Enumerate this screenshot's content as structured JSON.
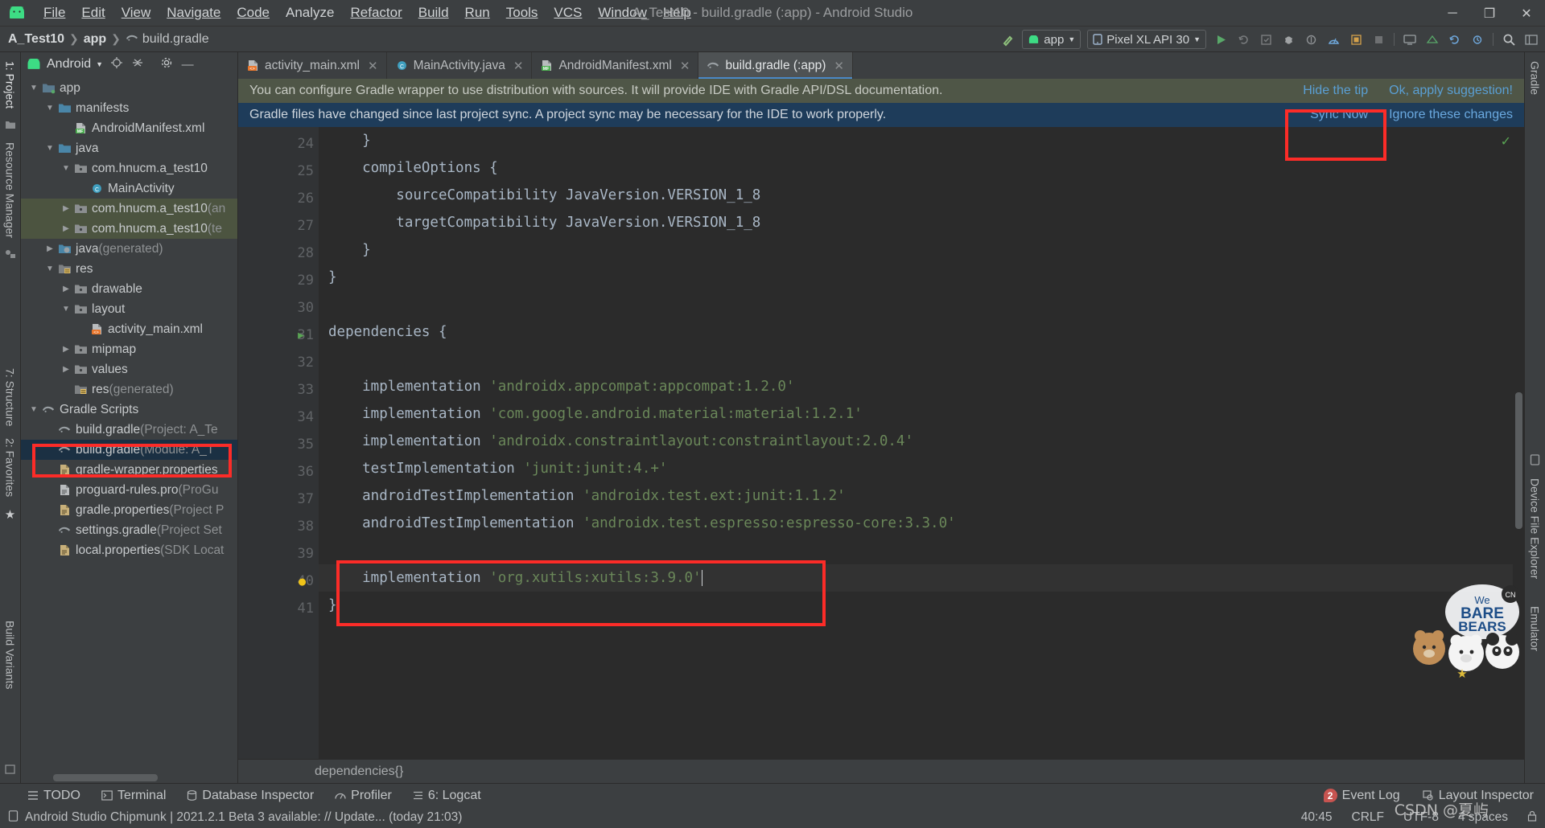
{
  "window": {
    "title": "A_Test10 - build.gradle (:app) - Android Studio",
    "minimize": "─",
    "maximize": "❐",
    "close": "✕"
  },
  "menu": {
    "items": [
      {
        "label": "File"
      },
      {
        "label": "Edit"
      },
      {
        "label": "View"
      },
      {
        "label": "Navigate"
      },
      {
        "label": "Code"
      },
      {
        "label": "Analyze"
      },
      {
        "label": "Refactor"
      },
      {
        "label": "Build"
      },
      {
        "label": "Run"
      },
      {
        "label": "Tools"
      },
      {
        "label": "VCS"
      },
      {
        "label": "Window"
      },
      {
        "label": "Help"
      }
    ]
  },
  "navbar": {
    "breadcrumbs": [
      "A_Test10",
      "app",
      "build.gradle"
    ],
    "module_combo": "app",
    "device_combo": "Pixel XL API 30",
    "icons": [
      "hammer-icon",
      "run-icon",
      "rerun-icon",
      "apply-changes-icon",
      "debug-icon",
      "attach-debugger-icon",
      "profile-icon",
      "layout-inspector-icon",
      "stop-icon",
      "avd-manager-icon",
      "sdk-manager-icon",
      "sync-gradle-icon",
      "search-everywhere-icon",
      "project-structure-icon"
    ]
  },
  "leftstrip": {
    "project_tab": "1: Project",
    "resource_tab": "Resource Manager",
    "structure_tab": "7: Structure",
    "favorites_tab": "2: Favorites",
    "buildvariants_tab": "Build Variants"
  },
  "rightstrip": {
    "gradle_tab": "Gradle",
    "device_tab": "Device File Explorer",
    "emulator_tab": "Emulator"
  },
  "project_panel": {
    "title": "Android",
    "icons": [
      "android-icon",
      "chevron-down-icon",
      "locate-icon",
      "collapse-all-icon",
      "settings-gear-icon",
      "hide-icon"
    ],
    "tree": [
      {
        "label": "app",
        "depth": 0,
        "arrow": "▼",
        "icon": "module-icon",
        "suffix": ""
      },
      {
        "label": "manifests",
        "depth": 1,
        "arrow": "▼",
        "icon": "folder-icon",
        "suffix": ""
      },
      {
        "label": "AndroidManifest.xml",
        "depth": 2,
        "arrow": "",
        "icon": "manifest-file-icon",
        "suffix": ""
      },
      {
        "label": "java",
        "depth": 1,
        "arrow": "▼",
        "icon": "folder-icon",
        "suffix": ""
      },
      {
        "label": "com.hnucm.a_test10",
        "depth": 2,
        "arrow": "▼",
        "icon": "package-icon",
        "suffix": ""
      },
      {
        "label": "MainActivity",
        "depth": 3,
        "arrow": "",
        "icon": "class-icon",
        "suffix": ""
      },
      {
        "label": "com.hnucm.a_test10",
        "depth": 2,
        "arrow": "▶",
        "icon": "package-icon",
        "suffix": " (an"
      },
      {
        "label": "com.hnucm.a_test10",
        "depth": 2,
        "arrow": "▶",
        "icon": "package-icon",
        "suffix": " (te"
      },
      {
        "label": "java",
        "depth": 1,
        "arrow": "▶",
        "icon": "generated-folder-icon",
        "suffix": " (generated)"
      },
      {
        "label": "res",
        "depth": 1,
        "arrow": "▼",
        "icon": "res-folder-icon",
        "suffix": ""
      },
      {
        "label": "drawable",
        "depth": 2,
        "arrow": "▶",
        "icon": "package-icon",
        "suffix": ""
      },
      {
        "label": "layout",
        "depth": 2,
        "arrow": "▼",
        "icon": "package-icon",
        "suffix": ""
      },
      {
        "label": "activity_main.xml",
        "depth": 3,
        "arrow": "",
        "icon": "layout-file-icon",
        "suffix": ""
      },
      {
        "label": "mipmap",
        "depth": 2,
        "arrow": "▶",
        "icon": "package-icon",
        "suffix": ""
      },
      {
        "label": "values",
        "depth": 2,
        "arrow": "▶",
        "icon": "package-icon",
        "suffix": ""
      },
      {
        "label": "res",
        "depth": 2,
        "arrow": "",
        "icon": "res-folder-icon",
        "suffix": " (generated)"
      },
      {
        "label": "Gradle Scripts",
        "depth": 0,
        "arrow": "▼",
        "icon": "gradle-icon",
        "suffix": ""
      },
      {
        "label": "build.gradle",
        "depth": 1,
        "arrow": "",
        "icon": "gradle-icon",
        "suffix": " (Project: A_Te"
      },
      {
        "label": "build.gradle",
        "depth": 1,
        "arrow": "",
        "icon": "gradle-icon",
        "suffix": " (Module: A_T"
      },
      {
        "label": "gradle-wrapper.properties",
        "depth": 1,
        "arrow": "",
        "icon": "properties-icon",
        "suffix": ""
      },
      {
        "label": "proguard-rules.pro",
        "depth": 1,
        "arrow": "",
        "icon": "text-file-icon",
        "suffix": " (ProGu"
      },
      {
        "label": "gradle.properties",
        "depth": 1,
        "arrow": "",
        "icon": "properties-icon",
        "suffix": " (Project P"
      },
      {
        "label": "settings.gradle",
        "depth": 1,
        "arrow": "",
        "icon": "gradle-icon",
        "suffix": " (Project Set"
      },
      {
        "label": "local.properties",
        "depth": 1,
        "arrow": "",
        "icon": "properties-icon",
        "suffix": " (SDK Locat"
      }
    ],
    "selected_index": 18,
    "test_source_indices": [
      6,
      7
    ]
  },
  "editor": {
    "tabs": [
      {
        "label": "activity_main.xml",
        "icon": "layout-file-icon",
        "active": false,
        "close": "✕"
      },
      {
        "label": "MainActivity.java",
        "icon": "class-icon",
        "active": false,
        "close": "✕"
      },
      {
        "label": "AndroidManifest.xml",
        "icon": "manifest-file-icon",
        "active": false,
        "close": "✕"
      },
      {
        "label": "build.gradle (:app)",
        "icon": "gradle-icon",
        "active": true,
        "close": "✕"
      }
    ],
    "tip_banner": {
      "text": "You can configure Gradle wrapper to use distribution with sources. It will provide IDE with Gradle API/DSL documentation.",
      "link1": "Hide the tip",
      "link2": "Ok, apply suggestion!"
    },
    "sync_banner": {
      "text": "Gradle files have changed since last project sync. A project sync may be necessary for the IDE to work properly.",
      "link1": "Sync Now",
      "link2": "Ignore these changes"
    },
    "code_lines": [
      {
        "n": "24",
        "text": "    }",
        "fold": "⊖",
        "type": "plain"
      },
      {
        "n": "25",
        "text": "    compileOptions {",
        "fold": "⊖",
        "type": "plain"
      },
      {
        "n": "26",
        "text": "        sourceCompatibility JavaVersion.VERSION_1_8",
        "fold": "",
        "type": "plain"
      },
      {
        "n": "27",
        "text": "        targetCompatibility JavaVersion.VERSION_1_8",
        "fold": "",
        "type": "plain"
      },
      {
        "n": "28",
        "text": "    }",
        "fold": "⊖",
        "type": "plain"
      },
      {
        "n": "29",
        "text": "}",
        "fold": "⊖",
        "type": "plain"
      },
      {
        "n": "30",
        "text": "",
        "fold": "",
        "type": "plain"
      },
      {
        "n": "31",
        "text": "dependencies {",
        "fold": "⊖",
        "type": "run",
        "run": "▶"
      },
      {
        "n": "32",
        "text": "",
        "fold": "",
        "type": "plain"
      },
      {
        "n": "33",
        "code": "    implementation ",
        "string": "'androidx.appcompat:appcompat:1.2.0'",
        "type": "dep"
      },
      {
        "n": "34",
        "code": "    implementation ",
        "string": "'com.google.android.material:material:1.2.1'",
        "type": "dep"
      },
      {
        "n": "35",
        "code": "    implementation ",
        "string": "'androidx.constraintlayout:constraintlayout:2.0.4'",
        "type": "dep"
      },
      {
        "n": "36",
        "code": "    testImplementation ",
        "string": "'junit:junit:4.+'",
        "type": "dep"
      },
      {
        "n": "37",
        "code": "    androidTestImplementation ",
        "string": "'androidx.test.ext:junit:1.1.2'",
        "type": "dep"
      },
      {
        "n": "38",
        "code": "    androidTestImplementation ",
        "string": "'androidx.test.espresso:espresso-core:3.3.0'",
        "type": "dep"
      },
      {
        "n": "39",
        "text": "",
        "fold": "",
        "type": "plain"
      },
      {
        "n": "40",
        "code": "    implementation ",
        "string": "'org.xutils:xutils:3.9.0'",
        "type": "dep-current",
        "bulb": "💡"
      },
      {
        "n": "41",
        "text": "}",
        "fold": "⊖",
        "type": "plain"
      }
    ],
    "breadcrumb": "dependencies{}"
  },
  "toolwindows": {
    "left_items": [
      {
        "label": "TODO",
        "icon": "todo-icon"
      },
      {
        "label": "Terminal",
        "icon": "terminal-icon"
      },
      {
        "label": "Database Inspector",
        "icon": "database-icon"
      },
      {
        "label": "Profiler",
        "icon": "profiler-icon"
      },
      {
        "label": "6: Logcat",
        "icon": "logcat-icon"
      }
    ],
    "right_items": [
      {
        "label": "Event Log",
        "icon": "event-log-icon",
        "badge": "2"
      },
      {
        "label": "Layout Inspector",
        "icon": "layout-inspector-icon",
        "badge": ""
      }
    ]
  },
  "statusbar": {
    "message": "Android Studio Chipmunk | 2021.2.1 Beta 3 available: // Update... (today 21:03)",
    "caret": "40:45",
    "line_ending": "CRLF",
    "encoding": "UTF-8",
    "indent": "4 spaces",
    "lock_icon": "lock-icon"
  },
  "watermark": {
    "text": "CSDN @夏屿"
  },
  "colors": {
    "accent_blue": "#4a88c7",
    "red_highlight": "#fc2c28",
    "selection": "#1b3043",
    "string_green": "#6a8759",
    "editor_bg": "#2b2b2b",
    "panel_bg": "#3c3f41"
  }
}
